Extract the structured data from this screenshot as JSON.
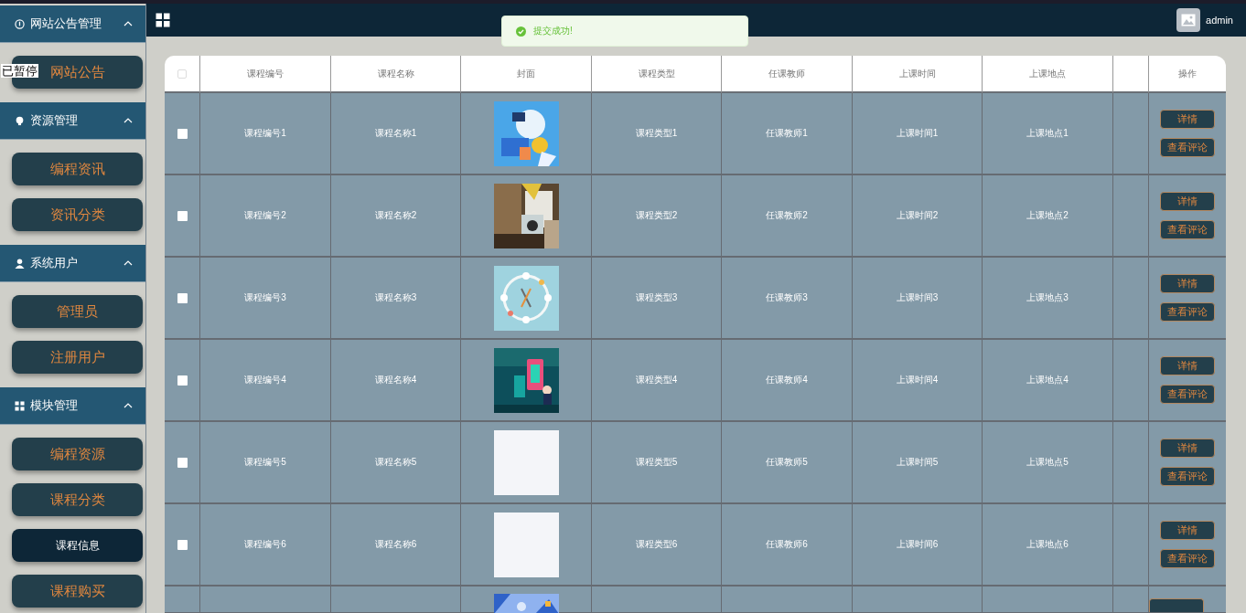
{
  "overlay_label": "已暂停",
  "sidebar": {
    "groups": [
      {
        "title": "网站公告管理",
        "expanded": true,
        "items": [
          {
            "label": "网站公告",
            "selected": false
          }
        ]
      },
      {
        "title": "资源管理",
        "expanded": true,
        "items": [
          {
            "label": "编程资讯",
            "selected": false
          },
          {
            "label": "资讯分类",
            "selected": false
          }
        ]
      },
      {
        "title": "系统用户",
        "expanded": true,
        "items": [
          {
            "label": "管理员",
            "selected": false
          },
          {
            "label": "注册用户",
            "selected": false
          }
        ]
      },
      {
        "title": "模块管理",
        "expanded": true,
        "items": [
          {
            "label": "编程资源",
            "selected": false
          },
          {
            "label": "课程分类",
            "selected": false
          },
          {
            "label": "课程信息",
            "selected": true
          },
          {
            "label": "课程购买",
            "selected": false
          }
        ]
      }
    ]
  },
  "header": {
    "user": "admin"
  },
  "toast": {
    "kind": "success",
    "message": "提交成功!"
  },
  "table": {
    "all_checked": false,
    "columns": [
      "课程编号",
      "课程名称",
      "封面",
      "课程类型",
      "任课教师",
      "上课时间",
      "上课地点",
      "操作"
    ],
    "rows": [
      {
        "checked": false,
        "cells": [
          "课程编号1",
          "课程名称1"
        ],
        "cover": {
          "kind": "picture"
        },
        "details": [
          "课程类型1",
          "任课教师1",
          "上课时间1",
          "上课地点1"
        ],
        "actions": [
          "详情",
          "查看评论"
        ]
      },
      {
        "checked": false,
        "cells": [
          "课程编号2",
          "课程名称2"
        ],
        "cover": {
          "kind": "picture"
        },
        "details": [
          "课程类型2",
          "任课教师2",
          "上课时间2",
          "上课地点2"
        ],
        "actions": [
          "详情",
          "查看评论"
        ]
      },
      {
        "checked": false,
        "cells": [
          "课程编号3",
          "课程名称3"
        ],
        "cover": {
          "kind": "picture"
        },
        "details": [
          "课程类型3",
          "任课教师3",
          "上课时间3",
          "上课地点3"
        ],
        "actions": [
          "详情",
          "查看评论"
        ]
      },
      {
        "checked": false,
        "cells": [
          "课程编号4",
          "课程名称4"
        ],
        "cover": {
          "kind": "picture"
        },
        "details": [
          "课程类型4",
          "任课教师4",
          "上课时间4",
          "上课地点4"
        ],
        "actions": [
          "详情",
          "查看评论"
        ]
      },
      {
        "checked": false,
        "cells": [
          "课程编号5",
          "课程名称5"
        ],
        "cover": {
          "kind": "blank"
        },
        "details": [
          "课程类型5",
          "任课教师5",
          "上课时间5",
          "上课地点5"
        ],
        "actions": [
          "详情",
          "查看评论"
        ]
      },
      {
        "checked": false,
        "cells": [
          "课程编号6",
          "课程名称6"
        ],
        "cover": {
          "kind": "blank"
        },
        "details": [
          "课程类型6",
          "任课教师6",
          "上课时间6",
          "上课地点6"
        ],
        "actions": [
          "详情",
          "查看评论"
        ]
      },
      {
        "cover": {
          "kind": "picture"
        }
      }
    ]
  }
}
